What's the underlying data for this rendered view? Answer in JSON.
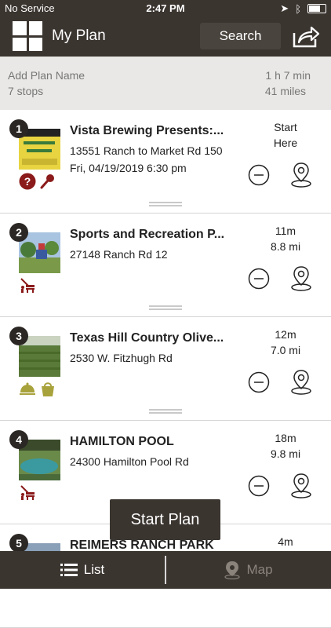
{
  "status_bar": {
    "carrier": "No Service",
    "time": "2:47 PM"
  },
  "header": {
    "title": "My Plan",
    "search_label": "Search"
  },
  "summary": {
    "plan_name_placeholder": "Add Plan Name",
    "stops": "7 stops",
    "duration": "1 h 7 min",
    "distance": "41 miles"
  },
  "stops": [
    {
      "number": "1",
      "name": "Vista Brewing Presents:...",
      "address": "13551 Ranch to Market Rd 150",
      "date": "Fri, 04/19/2019 6:30 pm",
      "line1": "Start",
      "line2": "Here"
    },
    {
      "number": "2",
      "name": "Sports and Recreation P...",
      "address": "27148 Ranch Rd 12",
      "line1": "11m",
      "line2": "8.8 mi"
    },
    {
      "number": "3",
      "name": "Texas Hill Country Olive...",
      "address": "2530 W. Fitzhugh Rd",
      "line1": "12m",
      "line2": "7.0 mi"
    },
    {
      "number": "4",
      "name": "HAMILTON POOL",
      "address": "24300 Hamilton Pool Rd",
      "line1": "18m",
      "line2": "9.8 mi"
    },
    {
      "number": "5",
      "name": "REIMERS RANCH PARK",
      "address": "",
      "line1": "4m",
      "line2": ""
    }
  ],
  "start_plan_label": "Start Plan",
  "tabs": {
    "list": "List",
    "map": "Map"
  },
  "colors": {
    "brand_dark": "#3b3530",
    "maroon": "#8b1a1a",
    "olive": "#a8a23c"
  }
}
